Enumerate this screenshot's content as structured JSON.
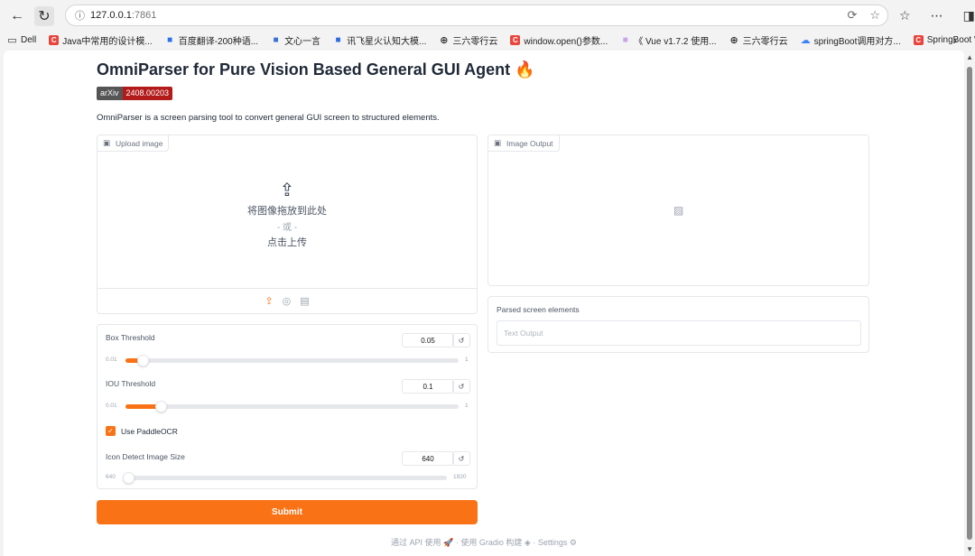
{
  "browser": {
    "url_host": "127.0.0.1",
    "url_port": ":7861",
    "back_icon": "arrow-left-icon",
    "reload_icon": "reload-icon"
  },
  "bookmarks": [
    {
      "label": "Dell",
      "icon": "folder-icon",
      "color": ""
    },
    {
      "label": "Java中常用的设计模...",
      "icon": "c-logo-icon",
      "color": "#e8453c"
    },
    {
      "label": "百度翻译-200种语...",
      "icon": "baidu-translate-icon",
      "color": "#2f6fea"
    },
    {
      "label": "文心一言",
      "icon": "wenxin-icon",
      "color": "#3a6fd8"
    },
    {
      "label": "讯飞星火认知大模...",
      "icon": "xunfei-icon",
      "color": "#2a6de0"
    },
    {
      "label": "三六零行云",
      "icon": "globe-icon",
      "color": ""
    },
    {
      "label": "window.open()参数...",
      "icon": "c-logo-icon",
      "color": "#e8453c"
    },
    {
      "label": "《 Vue v1.7.2 使用...",
      "icon": "doc-icon",
      "color": "#c9a3e8"
    },
    {
      "label": "三六零行云",
      "icon": "globe-icon",
      "color": ""
    },
    {
      "label": "springBoot调用对方...",
      "icon": "cloud-icon",
      "color": "#3b82f6"
    },
    {
      "label": "SpringBoot WebSer...",
      "icon": "c-logo-icon",
      "color": "#e8453c"
    }
  ],
  "header": {
    "title": "OmniParser for Pure Vision Based General GUI Agent",
    "title_emoji": "🔥",
    "badge_left": "arXiv",
    "badge_right": "2408.00203",
    "description": "OmniParser is a screen parsing tool to convert general GUI screen to structured elements."
  },
  "upload": {
    "label": "Upload image",
    "drop_text": "将图像拖放到此处",
    "or_text": "- 或 -",
    "click_text": "点击上传"
  },
  "output": {
    "image_label": "Image Output",
    "parsed_label": "Parsed screen elements",
    "text_placeholder": "Text Output"
  },
  "controls": {
    "box_threshold": {
      "label": "Box Threshold",
      "value": "0.05",
      "min": "0.01",
      "max": "1",
      "fill": 0.04
    },
    "iou_threshold": {
      "label": "IOU Threshold",
      "value": "0.1",
      "min": "0.01",
      "max": "1",
      "fill": 0.09
    },
    "use_paddle": {
      "label": "Use PaddleOCR",
      "checked": true
    },
    "icon_size": {
      "label": "Icon Detect Image Size",
      "value": "640",
      "min": "640",
      "max": "1920",
      "fill": 0.0
    }
  },
  "submit_label": "Submit",
  "footer": {
    "api": "通过 API 使用",
    "gradio": "使用 Gradio 构建",
    "settings": "Settings",
    "sep": "·"
  },
  "colors": {
    "accent": "#f97316",
    "arxiv_red": "#b31b1b"
  }
}
